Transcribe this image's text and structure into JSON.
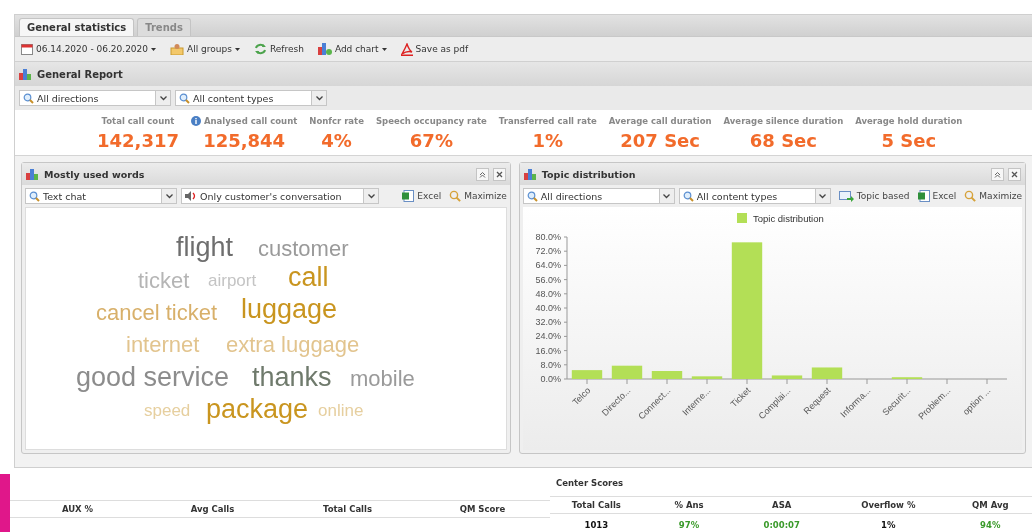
{
  "tabs": [
    {
      "label": "General statistics",
      "selected": true
    },
    {
      "label": "Trends",
      "selected": false
    }
  ],
  "toolbar": [
    {
      "kind": "calendar",
      "label": "06.14.2020 - 06.20.2020",
      "dropdown": true
    },
    {
      "kind": "groups",
      "label": "All groups",
      "dropdown": true
    },
    {
      "kind": "refresh",
      "label": "Refresh",
      "dropdown": false
    },
    {
      "kind": "chart",
      "label": "Add chart",
      "dropdown": true
    },
    {
      "kind": "pdf",
      "label": "Save as pdf",
      "dropdown": false
    }
  ],
  "report": {
    "title": "General Report",
    "filters": [
      "All directions",
      "All content types"
    ],
    "stats": [
      {
        "label": "Total call count",
        "value": "142,317",
        "info": false
      },
      {
        "label": "Analysed call count",
        "value": "125,844",
        "info": true
      },
      {
        "label": "Nonfcr rate",
        "value": "4%",
        "info": false
      },
      {
        "label": "Speech occupancy rate",
        "value": "67%",
        "info": false
      },
      {
        "label": "Transferred call rate",
        "value": "1%",
        "info": false
      },
      {
        "label": "Average call duration",
        "value": "207 Sec",
        "info": false
      },
      {
        "label": "Average silence duration",
        "value": "68 Sec",
        "info": false
      },
      {
        "label": "Average hold duration",
        "value": "5 Sec",
        "info": false
      }
    ]
  },
  "words_panel": {
    "title": "Mostly used words",
    "filters": [
      {
        "kind": "search",
        "label": "Text chat"
      },
      {
        "kind": "speaker",
        "label": "Only customer's conversation"
      }
    ],
    "actions": [
      {
        "kind": "excel",
        "label": "Excel"
      },
      {
        "kind": "maximize",
        "label": "Maximize"
      }
    ],
    "words": [
      {
        "text": "flight",
        "color": "#6e6e6e"
      },
      {
        "text": "customer",
        "color": "#9a9a9a"
      },
      {
        "text": "ticket",
        "color": "#b5b5b5"
      },
      {
        "text": "airport",
        "color": "#c4c4c4"
      },
      {
        "text": "call",
        "color": "#c9951f"
      },
      {
        "text": "cancel ticket",
        "color": "#d8b06a"
      },
      {
        "text": "luggage",
        "color": "#c9951f"
      },
      {
        "text": "internet",
        "color": "#e2c48e"
      },
      {
        "text": "extra luggage",
        "color": "#e2c48e"
      },
      {
        "text": "good service",
        "color": "#8c8c8c"
      },
      {
        "text": "thanks",
        "color": "#6f7a6c"
      },
      {
        "text": "mobile",
        "color": "#9a9a9a"
      },
      {
        "text": "speed",
        "color": "#e6cf9f"
      },
      {
        "text": "package",
        "color": "#c9951f"
      },
      {
        "text": "online",
        "color": "#e6cf9f"
      }
    ]
  },
  "topic_panel": {
    "title": "Topic distribution",
    "filters": [
      {
        "kind": "search",
        "label": "All directions"
      },
      {
        "kind": "search",
        "label": "All content types"
      }
    ],
    "actions": [
      {
        "kind": "topic",
        "label": "Topic based"
      },
      {
        "kind": "excel",
        "label": "Excel"
      },
      {
        "kind": "maximize",
        "label": "Maximize"
      }
    ],
    "chart_data": {
      "type": "bar",
      "categories": [
        "Telco",
        "Directo...",
        "Connect...",
        "Interne...",
        "Ticket",
        "Complai...",
        "Request",
        "Informa...",
        "Securit...",
        "Problem...",
        "option ..."
      ],
      "series": [
        {
          "name": "Topic distribution",
          "color": "#b3df56",
          "values": [
            5,
            7.5,
            4.5,
            1.5,
            77,
            2,
            6.5,
            0,
            1,
            0,
            0
          ]
        }
      ],
      "ylim": [
        0,
        80
      ],
      "yticks": [
        {
          "value": 0,
          "label": "0.0%"
        },
        {
          "value": 8,
          "label": "8.0%"
        },
        {
          "value": 16,
          "label": "16.0%"
        },
        {
          "value": 24,
          "label": "24.0%"
        },
        {
          "value": 32,
          "label": "32.0%"
        },
        {
          "value": 40,
          "label": "40.0%"
        },
        {
          "value": 48,
          "label": "48.0%"
        },
        {
          "value": 56,
          "label": "56.0%"
        },
        {
          "value": 64,
          "label": "64.0%"
        },
        {
          "value": 72,
          "label": "72.0%"
        },
        {
          "value": 80,
          "label": "80.0%"
        }
      ]
    }
  },
  "agent_table": {
    "columns": [
      "AUX %",
      "Avg Calls",
      "Total Calls",
      "QM Score"
    ]
  },
  "center_scores": {
    "title": "Center Scores",
    "columns": [
      "Total Calls",
      "% Ans",
      "ASA",
      "Overflow %",
      "QM Avg"
    ],
    "row": [
      {
        "value": "1013",
        "good": false
      },
      {
        "value": "97%",
        "good": true
      },
      {
        "value": "0:00:07",
        "good": true
      },
      {
        "value": "1%",
        "good": false
      },
      {
        "value": "94%",
        "good": true
      }
    ]
  }
}
